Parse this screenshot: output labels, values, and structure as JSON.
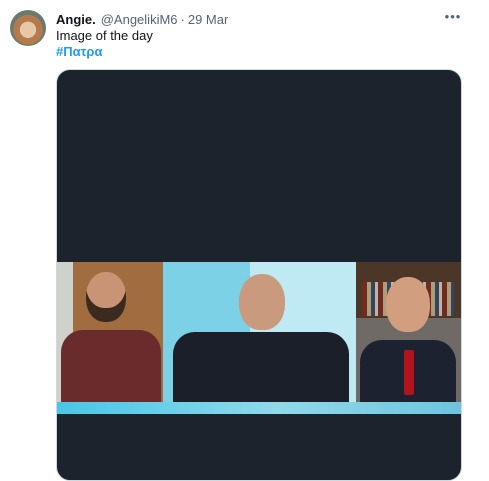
{
  "tweet": {
    "display_name": "Angie.",
    "handle": "@AngelikiM6",
    "separator": "·",
    "date": "29 Mar",
    "text": "Image of the day",
    "hashtag": "#Πατρα",
    "more_icon": "more-horizontal-icon"
  },
  "colors": {
    "link": "#1d9bf0",
    "secondary_text": "#536471",
    "media_background": "#1d232c"
  }
}
